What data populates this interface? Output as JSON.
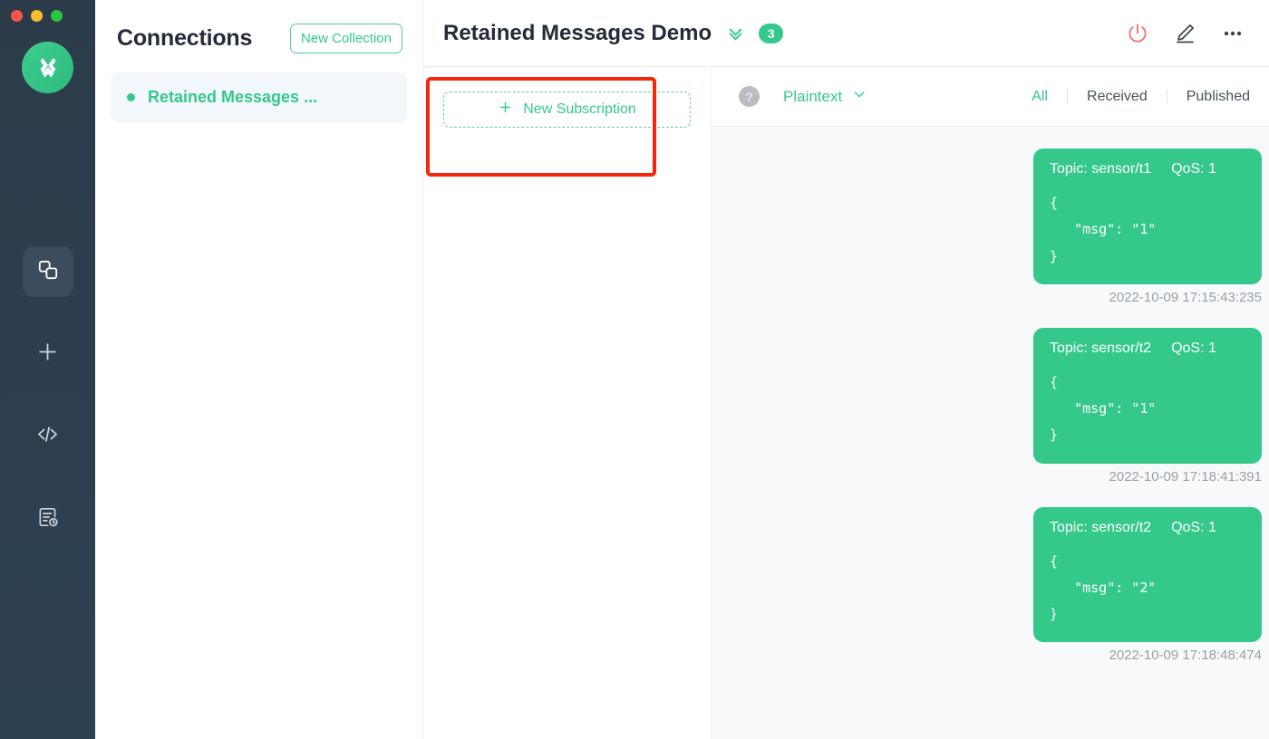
{
  "window": {
    "traffic_lights": [
      "close",
      "minimize",
      "maximize"
    ],
    "accent_green": "#34c98a",
    "rail_bg": "#2e4152",
    "annotation_color": "#f5270b"
  },
  "rail": {
    "logo_name": "mqttx-logo",
    "items": [
      {
        "name": "connections-icon",
        "label": "Connections",
        "active": true
      },
      {
        "name": "plus-icon",
        "label": "New Connection",
        "active": false
      },
      {
        "name": "code-icon",
        "label": "Scripts",
        "active": false
      },
      {
        "name": "log-history-icon",
        "label": "Log",
        "active": false
      }
    ]
  },
  "connections": {
    "title": "Connections",
    "new_collection_label": "New Collection",
    "items": [
      {
        "name": "Retained Messages ...",
        "status": "connected"
      }
    ]
  },
  "header": {
    "title": "Retained Messages Demo",
    "chevron_icon": "chevron-double-down-icon",
    "badge_count": "3",
    "actions": [
      {
        "name": "power-icon",
        "label": "Disconnect",
        "color": "#f0736b"
      },
      {
        "name": "edit-pencil-icon",
        "label": "Edit",
        "color": "#3b4452"
      },
      {
        "name": "more-horizontal-icon",
        "label": "More",
        "color": "#3b4452"
      }
    ]
  },
  "subscriptions": {
    "new_subscription_label": "New Subscription",
    "plus_icon": "plus-icon",
    "collapse_icon": "collapse-left-icon"
  },
  "toolbar": {
    "help_icon": "question-mark-icon",
    "payload_format": "Plaintext",
    "payload_chevron": "chevron-down-icon",
    "filters": [
      {
        "label": "All",
        "active": true
      },
      {
        "label": "Received",
        "active": false
      },
      {
        "label": "Published",
        "active": false
      }
    ]
  },
  "messages": [
    {
      "topic_label": "Topic: sensor/t1",
      "qos_label": "QoS: 1",
      "payload": "{\n   \"msg\": \"1\"\n}",
      "time": "2022-10-09 17:15:43:235",
      "direction": "published"
    },
    {
      "topic_label": "Topic: sensor/t2",
      "qos_label": "QoS: 1",
      "payload": "{\n   \"msg\": \"1\"\n}",
      "time": "2022-10-09 17:18:41:391",
      "direction": "published"
    },
    {
      "topic_label": "Topic: sensor/t2",
      "qos_label": "QoS: 1",
      "payload": "{\n   \"msg\": \"2\"\n}",
      "time": "2022-10-09 17:18:48:474",
      "direction": "published"
    }
  ]
}
